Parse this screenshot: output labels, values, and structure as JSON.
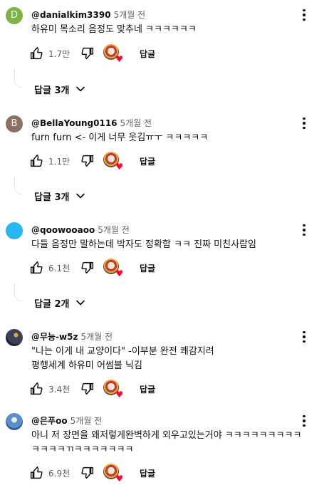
{
  "comments": [
    {
      "avatar_letter": "D",
      "avatar_color": "#7cb342",
      "author": "@danialkim3390",
      "time": "5개월 전",
      "lines": [
        "하유미 목소리 음정도 맞추네 ㅋㅋㅋㅋㅋㅋ"
      ],
      "likes": "1.7만",
      "reply_label": "답글",
      "replies_label": "답글 3개"
    },
    {
      "avatar_letter": "B",
      "avatar_color": "#8d6e63",
      "author": "@BellaYoung0116",
      "time": "5개월 전",
      "lines": [
        "furn furn <- 이게 너무 웃김ㅠㅜ ㅋㅋㅋㅋㅋ"
      ],
      "likes": "1.1만",
      "reply_label": "답글",
      "replies_label": "답글 3개"
    },
    {
      "avatar_letter": "",
      "avatar_color": "#29b6f6",
      "author": "@qoowooaoo",
      "time": "5개월 전",
      "lines": [
        "다들 음정만 말하는데 박자도 정확함 ㅋㅋ 진짜 미친사람임"
      ],
      "likes": "6.1천",
      "reply_label": "답글",
      "replies_label": "답글 2개"
    },
    {
      "avatar_letter": "",
      "avatar_color": "#3a3f5a",
      "author": "@무능-w5z",
      "time": "5개월 전",
      "lines": [
        "\"나는 이게 내 교양이다\" -이부분 완전 쾌감지려",
        "평행세계 하유미 어썸블 닉김"
      ],
      "likes": "3.4천",
      "reply_label": "답글",
      "replies_label": ""
    },
    {
      "avatar_letter": "",
      "avatar_color": "#5b8fc9",
      "author": "@은푸oo",
      "time": "5개월 전",
      "lines": [
        "아니 저 장면을 왜저렇게완벽하게 외우고있는거야 ㅋㅋㅋㅋㅋㅋㅋㅋㅋ",
        "ㅋㅋㅋㅋㄲㅋㅋㅋㅋㅋㅋㅋ"
      ],
      "likes": "6.9천",
      "reply_label": "답글",
      "replies_label": ""
    }
  ]
}
